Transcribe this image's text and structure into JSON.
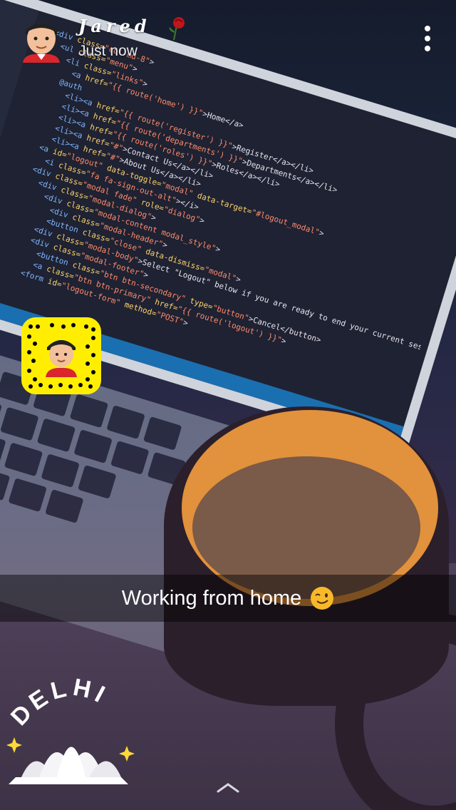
{
  "header": {
    "username": "Jared",
    "timestamp": "Just now"
  },
  "caption": {
    "text": "Working from home"
  },
  "geofilter": {
    "city": "DELHI"
  },
  "icons": {
    "avatar": "bitmoji-avatar-icon",
    "badge": "rose-icon",
    "menu": "more-vertical-icon",
    "snapcode": "snapcode-icon",
    "emoji": "winking-face-icon",
    "swipe": "chevron-up-icon"
  },
  "colors": {
    "snapcode_yellow": "#ffee00",
    "mug_rim": "#e2913c",
    "caption_bg": "rgba(0,0,0,0.45)"
  }
}
